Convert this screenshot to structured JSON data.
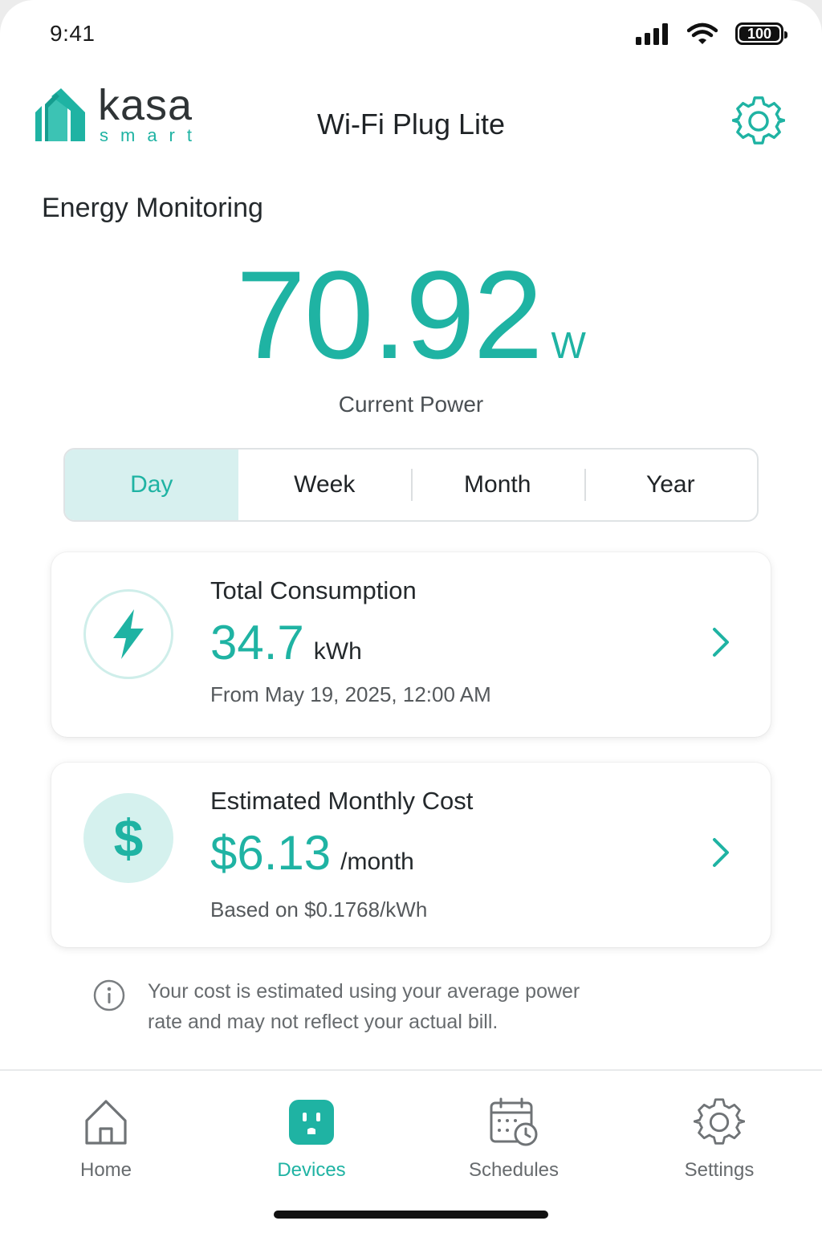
{
  "status_bar": {
    "time": "9:41",
    "battery": "100"
  },
  "header": {
    "logo_word": "kasa",
    "logo_sub": "smart",
    "device_name": "Wi-Fi Plug Lite"
  },
  "section": {
    "title": "Energy Monitoring"
  },
  "power": {
    "value": "70.92",
    "unit": "W",
    "label": "Current Power"
  },
  "periods": [
    {
      "label": "Day",
      "active": true
    },
    {
      "label": "Week",
      "active": false
    },
    {
      "label": "Month",
      "active": false
    },
    {
      "label": "Year",
      "active": false
    }
  ],
  "consumption": {
    "title": "Total Consumption",
    "value": "34.7",
    "unit": "kWh",
    "sub": "From May 19, 2025, 12:00 AM",
    "icon": "lightning-icon"
  },
  "cost": {
    "title": "Estimated Monthly Cost",
    "value": "$6.13",
    "unit": "/month",
    "sub": "Based on $0.1768/kWh",
    "icon_glyph": "$"
  },
  "info": {
    "line1": "Your cost is estimated using your average power",
    "line2": "rate and may not reflect your actual bill."
  },
  "tabs": [
    {
      "label": "Home",
      "icon": "house-icon",
      "active": false
    },
    {
      "label": "Devices",
      "icon": "plug-icon",
      "active": true
    },
    {
      "label": "Schedules",
      "icon": "calendar-clock-icon",
      "active": false
    },
    {
      "label": "Settings",
      "icon": "gear-icon",
      "active": false
    }
  ],
  "colors": {
    "accent": "#1fb3a3",
    "accent_light": "#d7f0ef",
    "text": "#1f2326",
    "muted": "#676b6e"
  }
}
